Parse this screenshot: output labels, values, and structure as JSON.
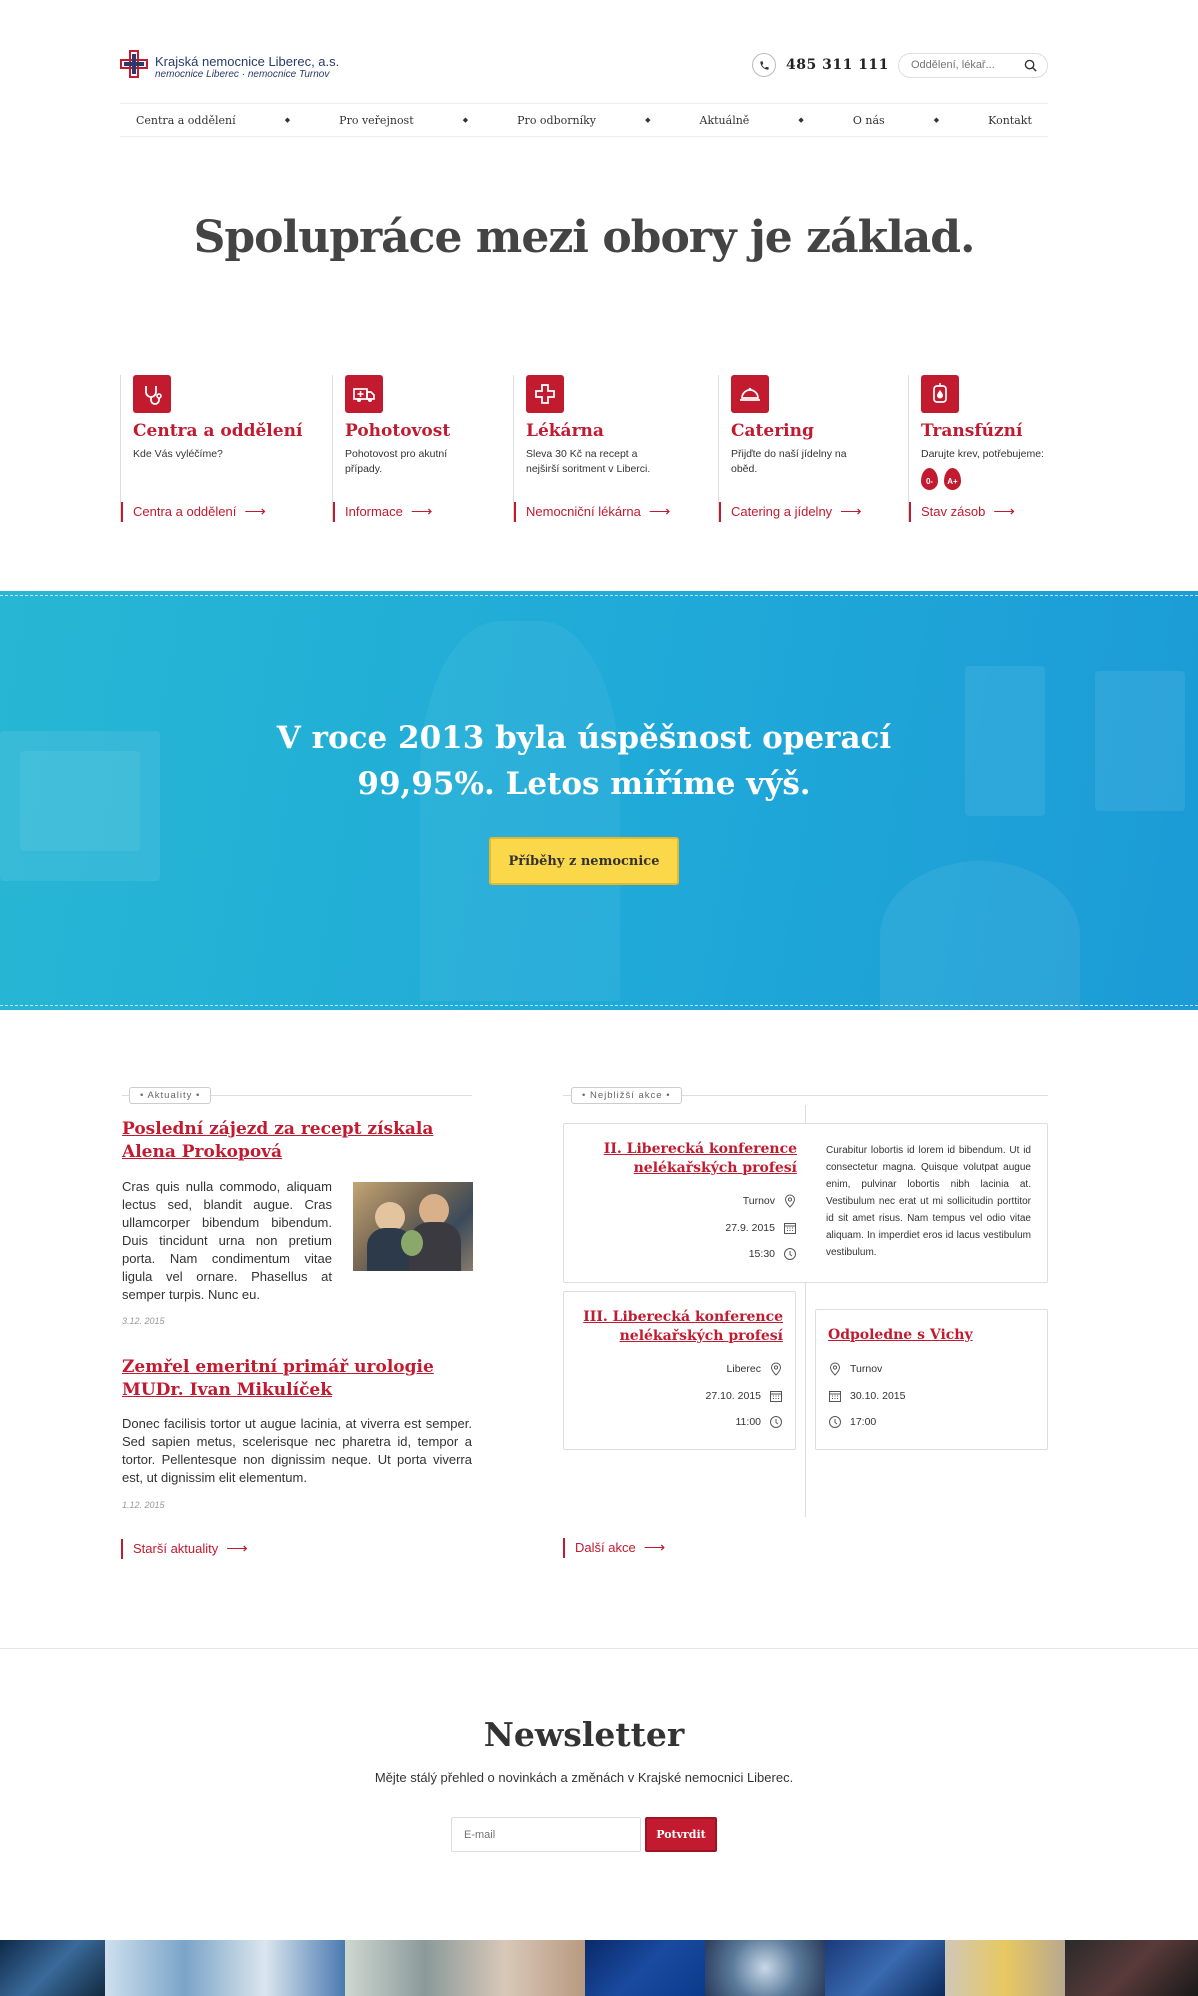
{
  "header": {
    "logo_name": "Krajská nemocnice Liberec, a.s.",
    "logo_sub": "nemocnice Liberec · nemocnice Turnov",
    "phone": "485 311 111",
    "search_placeholder": "Oddělení, lékař..."
  },
  "nav": [
    "Centra a oddělení",
    "Pro veřejnost",
    "Pro odborníky",
    "Aktuálně",
    "O nás",
    "Kontakt"
  ],
  "hero_title": "Spolupráce mezi obory je základ.",
  "services": [
    {
      "title": "Centra a oddělení",
      "desc": "Kde Vás vyléčíme?",
      "link": "Centra a oddělení",
      "icon": "stethoscope-icon"
    },
    {
      "title": "Pohotovost",
      "desc": "Pohotovost pro akutní případy.",
      "link": "Informace",
      "icon": "ambulance-icon"
    },
    {
      "title": "Lékárna",
      "desc": "Sleva 30 Kč na recept a nejširší soritment v Liberci.",
      "link": "Nemocniční lékárna",
      "icon": "pharmacy-cross-icon"
    },
    {
      "title": "Catering",
      "desc": "Přijďte do naší jídelny na oběd.",
      "link": "Catering a jídelny",
      "icon": "cloche-icon"
    },
    {
      "title": "Transfúzní",
      "desc": "Darujte krev, potřebujeme:",
      "link": "Stav zásob",
      "icon": "blood-bag-icon",
      "blood_types": [
        "0-",
        "A+"
      ]
    }
  ],
  "banner": {
    "title_line1": "V roce 2013 byla úspěšnost operací",
    "title_line2": "99,95%. Letos míříme výš.",
    "button": "Příběhy z nemocnice"
  },
  "news": {
    "tag": "Aktuality",
    "items": [
      {
        "title": "Poslední zájezd za recept získala Alena Prokopová",
        "text": "Cras quis nulla commodo, aliquam lectus sed, blandit augue. Cras ullamcorper bibendum bibendum. Duis tincidunt urna non pretium porta. Nam condimentum vitae ligula vel ornare. Phasellus at semper turpis. Nunc eu.",
        "date": "3.12. 2015"
      },
      {
        "title": "Zemřel emeritní primář urologie MUDr. Ivan Mikulíček",
        "text": "Donec facilisis tortor ut augue lacinia, at viverra est semper. Sed sapien metus, scelerisque nec pharetra id, tempor a tortor. Pellentesque non dignissim neque. Ut porta viverra est, ut dignissim elit elementum.",
        "date": "1.12. 2015"
      }
    ],
    "more": "Starší aktuality"
  },
  "events": {
    "tag": "Nejbližší akce",
    "items": [
      {
        "title": "II. Liberecká konference nelékařských profesí",
        "place": "Turnov",
        "date": "27.9. 2015",
        "time": "15:30",
        "desc": "Curabitur lobortis id lorem id bibendum. Ut id consectetur magna. Quisque volutpat augue enim, pulvinar lobortis nibh lacinia at. Vestibulum nec erat ut mi sollicitudin porttitor id sit amet risus. Nam tempus vel odio vitae aliquam. In imperdiet eros id lacus vestibulum vestibulum."
      },
      {
        "title": "III. Liberecká konference nelékařských profesí",
        "place": "Liberec",
        "date": "27.10. 2015",
        "time": "11:00"
      },
      {
        "title": "Odpoledne s Vichy",
        "place": "Turnov",
        "date": "30.10. 2015",
        "time": "17:00"
      }
    ],
    "more": "Další akce"
  },
  "newsletter": {
    "title": "Newsletter",
    "subtitle": "Mějte stálý přehled o novinkách a změnách v Krajské nemocnici Liberec.",
    "placeholder": "E-mail",
    "button": "Potvrdit"
  },
  "colors": {
    "brand_red": "#c21a2f",
    "banner_blue": "#1fa9d8",
    "button_yellow": "#fbd84a"
  }
}
